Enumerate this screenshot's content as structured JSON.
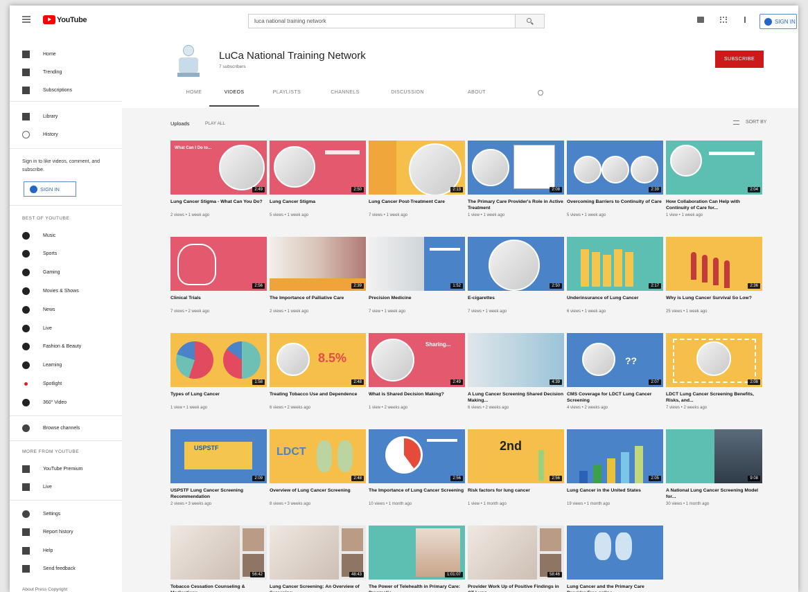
{
  "topbar": {
    "logo": "YouTube",
    "search_value": "luca national training network",
    "signin": "SIGN IN"
  },
  "sidebar": {
    "main": [
      {
        "label": "Home",
        "icon": "home-icon"
      },
      {
        "label": "Trending",
        "icon": "trending-icon"
      },
      {
        "label": "Subscriptions",
        "icon": "subscriptions-icon"
      }
    ],
    "library": [
      {
        "label": "Library",
        "icon": "library-icon"
      },
      {
        "label": "History",
        "icon": "history-icon"
      }
    ],
    "signin_prompt": "Sign in to like videos, comment, and subscribe.",
    "signin_button": "SIGN IN",
    "best_heading": "BEST OF YOUTUBE",
    "best": [
      {
        "label": "Music",
        "icon": "music-icon"
      },
      {
        "label": "Sports",
        "icon": "sports-icon"
      },
      {
        "label": "Gaming",
        "icon": "gaming-icon"
      },
      {
        "label": "Movies & Shows",
        "icon": "movies-icon"
      },
      {
        "label": "News",
        "icon": "news-icon"
      },
      {
        "label": "Live",
        "icon": "live-icon"
      },
      {
        "label": "Fashion & Beauty",
        "icon": "fashion-icon"
      },
      {
        "label": "Learning",
        "icon": "learning-icon"
      },
      {
        "label": "Spotlight",
        "icon": "spotlight-icon"
      },
      {
        "label": "360° Video",
        "icon": "360-video-icon"
      }
    ],
    "browse": {
      "label": "Browse channels",
      "icon": "browse-channels-icon"
    },
    "more_heading": "MORE FROM YOUTUBE",
    "more": [
      {
        "label": "YouTube Premium",
        "icon": "youtube-premium-icon"
      },
      {
        "label": "Live",
        "icon": "live-icon"
      }
    ],
    "settings": [
      {
        "label": "Settings",
        "icon": "settings-icon"
      },
      {
        "label": "Report history",
        "icon": "flag-icon"
      },
      {
        "label": "Help",
        "icon": "help-icon"
      },
      {
        "label": "Send feedback",
        "icon": "feedback-icon"
      }
    ],
    "footer": "About  Press  Copyright"
  },
  "channel": {
    "name": "LuCa National Training Network",
    "subscribers": "7 subscribers",
    "subscribe": "SUBSCRIBE",
    "tabs": [
      "HOME",
      "VIDEOS",
      "PLAYLISTS",
      "CHANNELS",
      "DISCUSSION",
      "ABOUT"
    ],
    "active_tab": "VIDEOS"
  },
  "uploads": {
    "label": "Uploads",
    "play_all": "PLAY ALL",
    "sort_by": "SORT BY"
  },
  "videos": [
    {
      "title": "Lung Cancer Stigma - What Can You Do?",
      "meta": "2 views • 1 week ago",
      "duration": "2:49",
      "theme": "pink"
    },
    {
      "title": "Lung Cancer Stigma",
      "meta": "5 views • 1 week ago",
      "duration": "2:50",
      "theme": "pink"
    },
    {
      "title": "Lung Cancer Post-Treatment Care",
      "meta": "7 views • 1 week ago",
      "duration": "2:13",
      "theme": "yellow"
    },
    {
      "title": "The Primary Care Provider's Role in Active Treatment",
      "meta": "1 view • 1 week ago",
      "duration": "2:08",
      "theme": "blue"
    },
    {
      "title": "Overcoming Barriers to Continuity of Care",
      "meta": "5 views • 1 week ago",
      "duration": "2:39",
      "theme": "blue"
    },
    {
      "title": "How Collaboration Can Help with Continuity of Care for...",
      "meta": "1 view • 1 week ago",
      "duration": "2:04",
      "theme": "teal"
    },
    {
      "title": "Clinical Trials",
      "meta": "7 views • 2 week ago",
      "duration": "2:56",
      "theme": "pink"
    },
    {
      "title": "The Importance of Palliative Care",
      "meta": "2 views • 1 week ago",
      "duration": "2:39",
      "theme": "orange"
    },
    {
      "title": "Precision Medicine",
      "meta": "7 view • 1 week ago",
      "duration": "1:52",
      "theme": "blue"
    },
    {
      "title": "E-cigarettes",
      "meta": "7 views • 1 week ago",
      "duration": "2:50",
      "theme": "blue"
    },
    {
      "title": "Underinsurance of Lung Cancer",
      "meta": "6 views • 1 week ago",
      "duration": "2:17",
      "theme": "teal"
    },
    {
      "title": "Why is Lung Cancer Survival So Low?",
      "meta": "25 views • 1 week ago",
      "duration": "2:36",
      "theme": "yellow"
    },
    {
      "title": "Types of Lung Cancer",
      "meta": "1 view • 1 week ago",
      "duration": "1:58",
      "theme": "yellow"
    },
    {
      "title": "Treating Tobacco Use and Dependence",
      "meta": "6 views • 2 weeks ago",
      "duration": "2:48",
      "theme": "yellow"
    },
    {
      "title": "What is Shared Decision Making?",
      "meta": "1 view • 2 weeks ago",
      "duration": "2:49",
      "theme": "blue"
    },
    {
      "title": "A Lung Cancer Screening Shared Decision Making...",
      "meta": "6 views • 2 weeks ago",
      "duration": "4:39",
      "theme": "blue"
    },
    {
      "title": "CMS Coverage for LDCT Lung Cancer Screening",
      "meta": "4 views • 2 weeks ago",
      "duration": "2:07",
      "theme": "blue"
    },
    {
      "title": "LDCT Lung Cancer Screening Benefits, Risks, and...",
      "meta": "7 views • 2 weeks ago",
      "duration": "2:08",
      "theme": "yellow"
    },
    {
      "title": "USPSTF Lung Cancer Screening Recommendation",
      "meta": "2 views • 3 weeks ago",
      "duration": "2:09",
      "theme": "blue"
    },
    {
      "title": "Overview of Lung Cancer Screening",
      "meta": "8 views • 3 weeks ago",
      "duration": "2:48",
      "theme": "yellow"
    },
    {
      "title": "The Importance of Lung Cancer Screening",
      "meta": "10 views • 1 month ago",
      "duration": "2:56",
      "theme": "blue"
    },
    {
      "title": "Risk factors for lung cancer",
      "meta": "1 view • 1 month ago",
      "duration": "2:56",
      "theme": "yellow"
    },
    {
      "title": "Lung Cancer in the United States",
      "meta": "19 views • 1 month ago",
      "duration": "2:05",
      "theme": "blue"
    },
    {
      "title": "A National Lung Cancer Screening Model for...",
      "meta": "30 views • 1 month ago",
      "duration": "9:08",
      "theme": "teal"
    },
    {
      "title": "Tobacco Cessation Counseling & Medications...",
      "meta": "",
      "duration": "56:42",
      "theme": "white"
    },
    {
      "title": "Lung Cancer Screening: An Overview of Screening...",
      "meta": "",
      "duration": "48:43",
      "theme": "white"
    },
    {
      "title": "The Power of Telehealth in Primary Care: Pragmatic...",
      "meta": "",
      "duration": "1:01:07",
      "theme": "teal"
    },
    {
      "title": "Provider Work Up of Positive Findings in CT Lung...",
      "meta": "",
      "duration": "58:46",
      "theme": "white"
    },
    {
      "title": "Lung Cancer and the Primary Care Provider Free online...",
      "meta": "",
      "duration": "",
      "theme": "blue"
    }
  ],
  "thumb_labels": {
    "t1": "What Can I Do to...",
    "t14": "8.5%",
    "t15": "Sharing...",
    "t17": "??",
    "t19": "USPSTF",
    "t20": "LDCT",
    "t22": "2nd"
  },
  "colors": {
    "pink": "#e35a6e",
    "yellow": "#f5bf4a",
    "blue": "#4b83c9",
    "teal": "#5cbfb2",
    "orange": "#f0a33b",
    "white": "#e9e9e9",
    "subscribe": "#cc1a1a"
  }
}
